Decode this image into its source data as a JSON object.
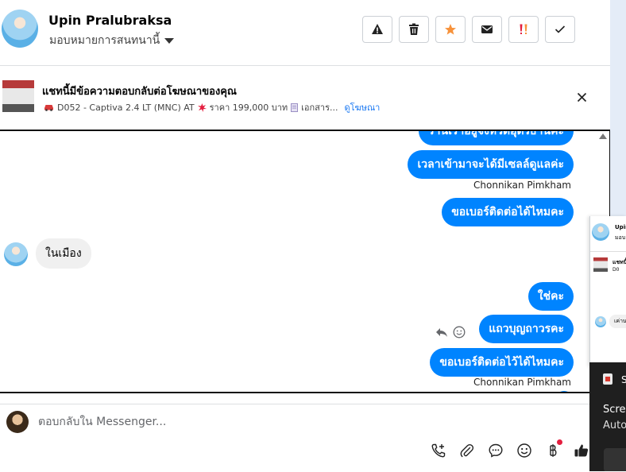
{
  "header": {
    "user_name": "Upin Pralubraksa",
    "assign_label": "มอบหมายการสนทนานี้",
    "tools": [
      {
        "name": "report-spam-button",
        "icon": "warning-icon"
      },
      {
        "name": "delete-button",
        "icon": "trash-icon"
      },
      {
        "name": "star-button",
        "icon": "star-icon"
      },
      {
        "name": "mark-unread-button",
        "icon": "envelope-icon"
      },
      {
        "name": "mark-important-button",
        "icon": "exclamation-icon"
      },
      {
        "name": "mark-done-button",
        "icon": "check-icon"
      }
    ]
  },
  "ad": {
    "title": "แชทนี้มีข้อความตอบกลับต่อโฆษณาของคุณ",
    "subtitle_car": "D052 - Captiva 2.4 LT (MNC) AT",
    "subtitle_price": "ราคา 199,000 บาท",
    "subtitle_docs": "เอกสาร...",
    "link": "ดูโฆษณา"
  },
  "thread": {
    "messages": [
      {
        "dir": "out",
        "text": "ร้านเราอยู่จังหวัดอุดรธานีค่ะ"
      },
      {
        "dir": "out",
        "text": "เวลาเข้ามาจะได้มีเซลล์ดูแลค่ะ"
      },
      {
        "dir": "meta",
        "text": "Chonnikan Pimkham"
      },
      {
        "dir": "out",
        "text": "ขอเบอร์ติดต่อได้ไหมคะ"
      },
      {
        "dir": "in",
        "text": "ในเมือง"
      },
      {
        "dir": "out",
        "text": "ใช่คะ"
      },
      {
        "dir": "out",
        "text": "แถวบุญถาวรคะ"
      },
      {
        "dir": "out",
        "text": "ขอเบอร์ติดต่อไว้ได้ไหมคะ"
      },
      {
        "dir": "meta",
        "text": "Chonnikan Pimkham"
      }
    ]
  },
  "composer": {
    "placeholder": "ตอบกลับใน Messenger..."
  },
  "mini_chat": {
    "name": "Upin",
    "assign": "มอบ",
    "ad_title": "แชทนี้",
    "ad_sub": "D0",
    "bubble": "เค่าน"
  },
  "notification": {
    "app": "S",
    "title": "Scree",
    "body": "Auto"
  },
  "colors": {
    "outgoing_bubble": "#0084ff",
    "incoming_bubble": "#f0f0f0",
    "link": "#1877f2",
    "star": "#f7923b",
    "important": "#e41e3f"
  }
}
